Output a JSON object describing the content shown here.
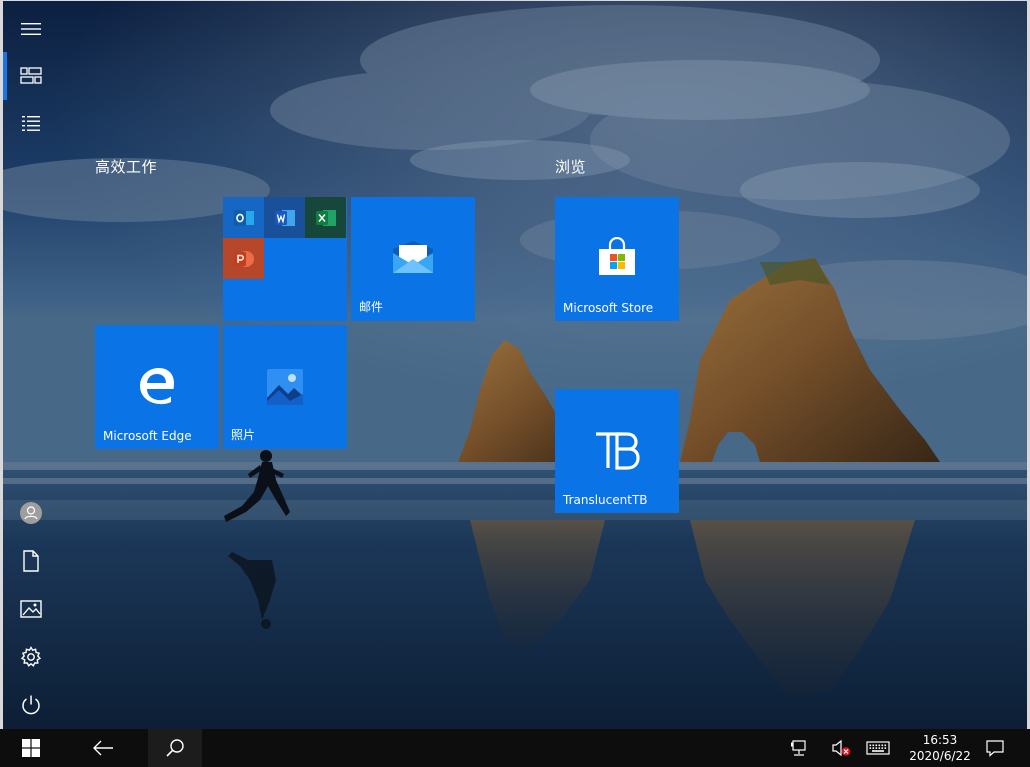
{
  "groups": [
    {
      "title": "高效工作"
    },
    {
      "title": "浏览"
    }
  ],
  "tiles": {
    "mail": {
      "label": "邮件"
    },
    "store": {
      "label": "Microsoft Store"
    },
    "edge": {
      "label": "Microsoft Edge"
    },
    "photos": {
      "label": "照片"
    },
    "translucenttb": {
      "label": "TranslucentTB"
    }
  },
  "office_folder": {
    "apps": [
      {
        "icon": "outlook-icon",
        "letter": "O",
        "color": "#0f5ea8"
      },
      {
        "icon": "word-icon",
        "letter": "W",
        "color": "#1e4f9c"
      },
      {
        "icon": "excel-icon",
        "letter": "X",
        "color": "#106b3c"
      },
      {
        "icon": "powerpoint-icon",
        "letter": "P",
        "color": "#c3380f"
      }
    ]
  },
  "left_rail": {
    "items": [
      {
        "icon": "hamburger-menu-icon"
      },
      {
        "icon": "tiles-view-icon"
      },
      {
        "icon": "all-apps-list-icon"
      },
      {
        "icon": "user-avatar-icon"
      },
      {
        "icon": "documents-icon"
      },
      {
        "icon": "pictures-icon"
      },
      {
        "icon": "settings-gear-icon"
      },
      {
        "icon": "power-icon"
      }
    ]
  },
  "taskbar": {
    "clock_time": "16:53",
    "clock_date": "2020/6/22"
  },
  "colors": {
    "tile_blue": "#0a74e6",
    "accent": "#1a73e8",
    "taskbar": "#0d0d0d"
  }
}
